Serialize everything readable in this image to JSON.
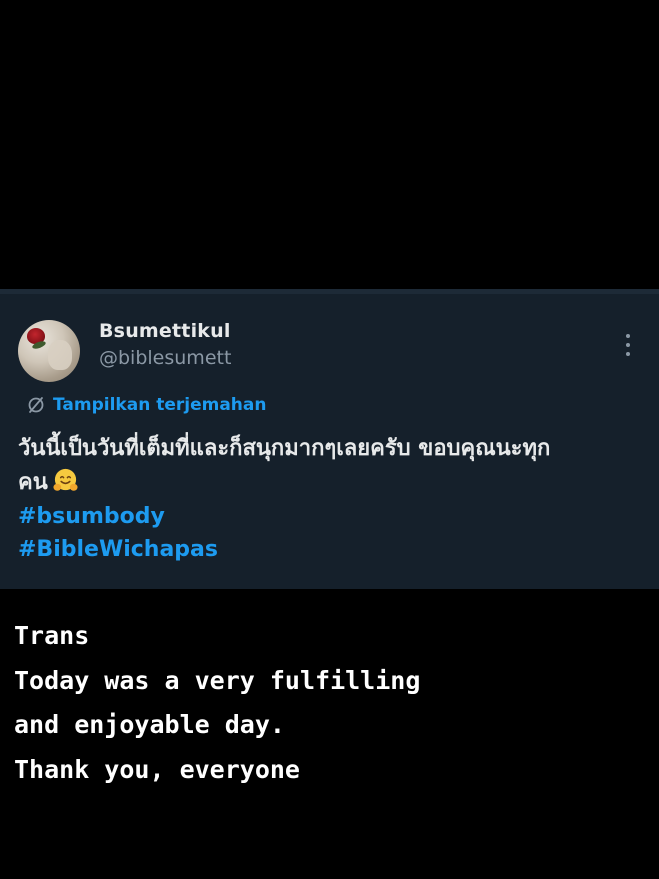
{
  "tweet": {
    "display_name": "Bsumettikul",
    "handle": "@biblesumett",
    "translate_label": "Tampilkan terjemahan",
    "text_line_1": "วันนี้เป็นวันที่เต็มที่และก็สนุกมากๆเลยครับ ขอบคุณนะทุก",
    "text_line_2": "คน",
    "emoji": "hugging-face-emoji",
    "hashtags": [
      "#bsumbody",
      "#BibleWichapas"
    ]
  },
  "caption": {
    "lines": [
      "Trans",
      "Today was a very fulfilling",
      "and enjoyable day.",
      "Thank you, everyone"
    ]
  },
  "colors": {
    "background": "#000000",
    "card_background": "#15202b",
    "text_primary": "#e7e9ea",
    "text_secondary": "#8b98a5",
    "accent_blue": "#1d9bf0",
    "caption_text": "#ffffff"
  },
  "icons": {
    "more": "more-vertical-icon",
    "translate": "translate-icon"
  }
}
